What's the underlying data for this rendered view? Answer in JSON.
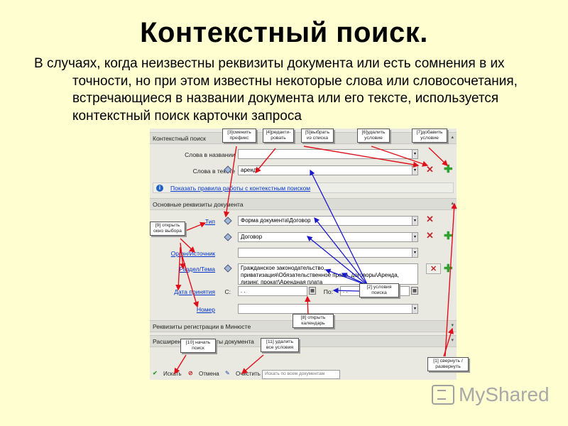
{
  "slide": {
    "title": "Контекстный поиск.",
    "intro_first": "В случаях, когда неизвестны реквизиты документа или есть сомнения в их",
    "intro_rest": "точности, но при этом известны некоторые слова или словосочетания, встречающиеся в названии документа или его тексте, используется контекстный поиск карточки запроса"
  },
  "form": {
    "section_context": "Контекстный поиск",
    "label_words_title": "Слова в названии",
    "label_words_text": "Слова в тексте",
    "value_words_text": "аренд",
    "info_link": "Показать правила работы с контекстным поиском",
    "section_basic": "Основные реквизиты документа",
    "label_type": "Тип",
    "value_type_1": "Форма документа\\Договор",
    "value_type_2": "Договор",
    "label_organ": "Орган/Источник",
    "label_section": "Раздел/Тема",
    "value_section": "Гражданское законодательство, приватизация\\Обязательственное право, договоры\\Аренда, лизинг, прокат\\Арендная плата",
    "label_date": "Дата принятия",
    "label_from": "С:",
    "label_to": "По:",
    "value_date_from": ". .",
    "value_date_to": ". .",
    "label_number": "Номер",
    "section_minjust": "Реквизиты регистрации в Минюсте",
    "section_extended": "Расширенные реквизиты документа",
    "btn_search": "Искать",
    "btn_cancel": "Отмена",
    "btn_clear": "Очистить",
    "search_scope": "Искать по всем документам"
  },
  "callouts": {
    "c3": "[3]сменить префикс",
    "c4": "[4]редакти-ровать",
    "c5": "[5]выбрать из списка",
    "c6": "[6]удалить условие",
    "c7": "[7]добавить условие",
    "c9": "[9] открыть окно выбора",
    "c2": "[2] условия поиска",
    "c8": "[8] открыть календарь",
    "c10": "[10] начать поиск",
    "c11": "[11] удалить все условия",
    "c1": "[1] свернуть / развернуть"
  },
  "icons": {
    "delete": "x-icon",
    "add": "plus-icon",
    "prefix": "diamond-icon",
    "info": "info-icon",
    "calendar": "calendar-icon"
  },
  "logo": {
    "text": "MyShared"
  },
  "colors": {
    "background": "#fefed0",
    "red_arrow": "#e0101a",
    "blue_arrow": "#1a1acc",
    "link": "#0033cc"
  }
}
